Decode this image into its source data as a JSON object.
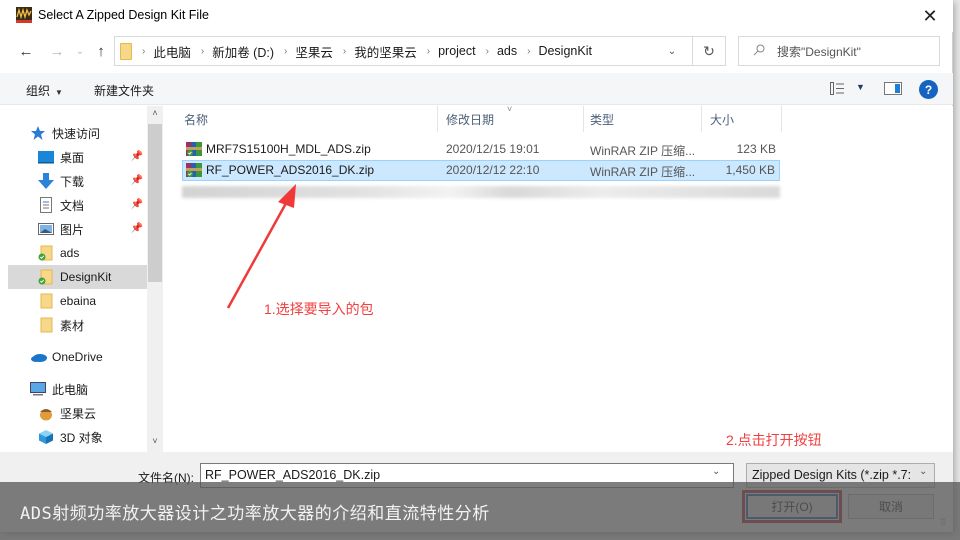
{
  "window": {
    "title": "Select A Zipped Design Kit File",
    "close_symbol": "✕"
  },
  "navigation": {
    "back_symbol": "←",
    "forward_symbol": "→",
    "recent_symbol": "⌄",
    "up_symbol": "↑",
    "breadcrumbs": [
      "此电脑",
      "新加卷 (D:)",
      "坚果云",
      "我的坚果云",
      "project",
      "ads",
      "DesignKit"
    ],
    "separator": "›",
    "dropdown_symbol": "⌄",
    "refresh_symbol": "↻",
    "search_placeholder": "搜索\"DesignKit\"",
    "search_symbol": "⚲"
  },
  "toolbar": {
    "organize_label": "组织",
    "organize_caret": "▼",
    "new_folder_label": "新建文件夹",
    "view_caret": "▼",
    "help_symbol": "?"
  },
  "sidebar": {
    "items": [
      {
        "label": "快速访问",
        "icon": "star-icon",
        "pinned": false
      },
      {
        "label": "桌面",
        "icon": "desktop-icon",
        "pinned": true
      },
      {
        "label": "下载",
        "icon": "download-icon",
        "pinned": true
      },
      {
        "label": "文档",
        "icon": "document-icon",
        "pinned": true
      },
      {
        "label": "图片",
        "icon": "picture-icon",
        "pinned": true
      },
      {
        "label": "ads",
        "icon": "synced-folder-icon",
        "pinned": false
      },
      {
        "label": "DesignKit",
        "icon": "synced-folder-icon",
        "pinned": false,
        "selected": true
      },
      {
        "label": "ebaina",
        "icon": "folder-icon",
        "pinned": false
      },
      {
        "label": "素材",
        "icon": "folder-icon",
        "pinned": false
      },
      {
        "label": "OneDrive",
        "icon": "onedrive-icon",
        "pinned": false
      },
      {
        "label": "此电脑",
        "icon": "computer-icon",
        "pinned": false
      },
      {
        "label": "坚果云",
        "icon": "nutstore-icon",
        "pinned": false
      },
      {
        "label": "3D 对象",
        "icon": "3d-objects-icon",
        "pinned": false
      }
    ],
    "pin_symbol": "📌",
    "scroll_up": "˄",
    "scroll_down": "˅"
  },
  "filelist": {
    "columns": [
      "名称",
      "修改日期",
      "类型",
      "大小"
    ],
    "sort_caret": "˅",
    "rows": [
      {
        "name": "MRF7S15100H_MDL_ADS.zip",
        "modified": "2020/12/15 19:01",
        "type": "WinRAR ZIP 压缩...",
        "size": "123 KB",
        "selected": false
      },
      {
        "name": "RF_POWER_ADS2016_DK.zip",
        "modified": "2020/12/12 22:10",
        "type": "WinRAR ZIP 压缩...",
        "size": "1,450 KB",
        "selected": true
      }
    ]
  },
  "annotations": {
    "step1": "1.选择要导入的包",
    "step2": "2.点击打开按钮"
  },
  "bottom": {
    "filename_label": "文件名(N):",
    "filename_value": "RF_POWER_ADS2016_DK.zip",
    "filter_value": "Zipped Design Kits (*.zip *.7:",
    "caret": "⌄",
    "open_label": "打开(O)",
    "cancel_label": "取消"
  },
  "caption": "ADS射频功率放大器设计之功率放大器的介绍和直流特性分析",
  "colors": {
    "accent": "#1a5fb4",
    "selection": "#cce8ff",
    "annotation": "#f04040",
    "highlight_box": "#b02020"
  }
}
